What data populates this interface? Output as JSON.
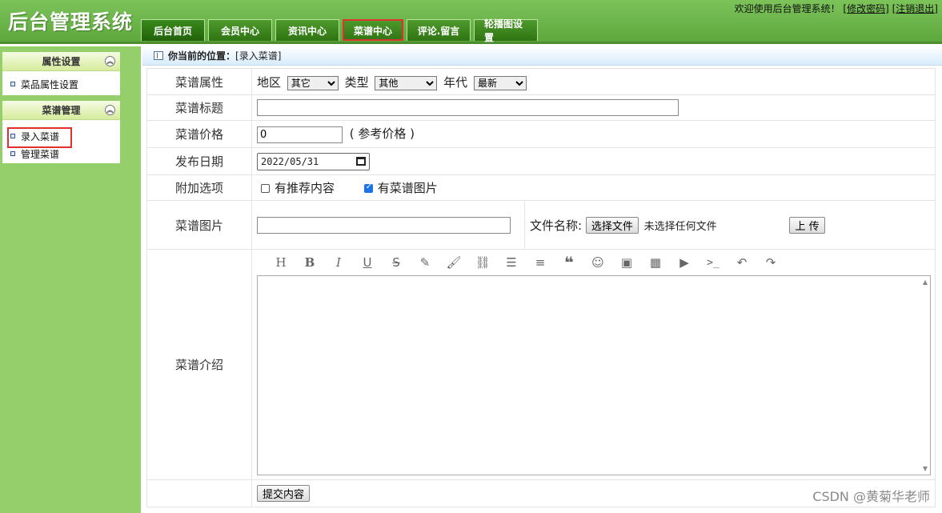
{
  "header": {
    "title": "后台管理系统",
    "welcome": "欢迎使用后台管理系统！",
    "change_password": "[修改密码]",
    "logout": "[注销退出]",
    "tabs": [
      {
        "label": "后台首页"
      },
      {
        "label": "会员中心"
      },
      {
        "label": "资讯中心"
      },
      {
        "label": "菜谱中心"
      },
      {
        "label": "评论.留言"
      },
      {
        "label": "轮播图设置"
      }
    ]
  },
  "sidebar": {
    "panels": [
      {
        "title": "属性设置",
        "items": [
          "菜品属性设置"
        ]
      },
      {
        "title": "菜谱管理",
        "items": [
          "录入菜谱",
          "管理菜谱"
        ]
      }
    ]
  },
  "breadcrumb": {
    "prefix": "你当前的位置：",
    "current": "[录入菜谱]"
  },
  "form": {
    "attr": {
      "label": "菜谱属性",
      "region_label": "地区",
      "region_value": "其它",
      "type_label": "类型",
      "type_value": "其他",
      "era_label": "年代",
      "era_value": "最新"
    },
    "title": {
      "label": "菜谱标题",
      "value": ""
    },
    "price": {
      "label": "菜谱价格",
      "value": "0",
      "hint": "( 参考价格 )"
    },
    "date": {
      "label": "发布日期",
      "value": "2022/05/31"
    },
    "options": {
      "label": "附加选项",
      "recommend": "有推荐内容",
      "has_image": "有菜谱图片",
      "recommend_checked": false,
      "image_checked": true
    },
    "image": {
      "label": "菜谱图片",
      "value": "",
      "file_label": "文件名称:",
      "choose_button": "选择文件",
      "no_file": "未选择任何文件",
      "upload_button": "上 传"
    },
    "intro": {
      "label": "菜谱介绍"
    },
    "submit": "提交内容"
  },
  "watermark": "CSDN @黄菊华老师",
  "colors": {
    "header_green": "#5ea83e",
    "sidebar_green": "#95cf6c",
    "highlight_red": "#e03030",
    "checkbox_blue": "#1a73e8"
  }
}
